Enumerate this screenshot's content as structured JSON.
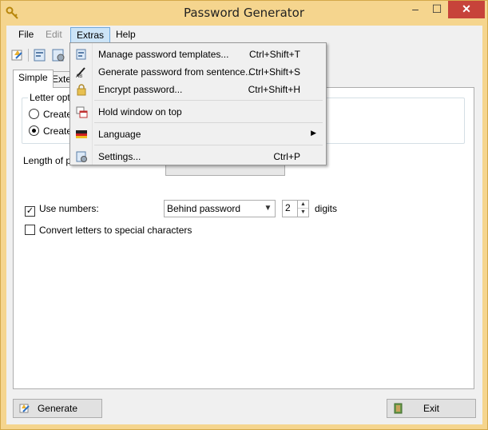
{
  "window": {
    "title": "Password Generator"
  },
  "titlebar_buttons": {
    "minimize": "–",
    "maximize": "☐",
    "close": "✕"
  },
  "menubar": {
    "file": "File",
    "edit": "Edit",
    "extras": "Extras",
    "help": "Help"
  },
  "tabs": {
    "simple": "Simple",
    "extended": "Exte"
  },
  "letter_options": {
    "title": "Letter opti",
    "option1": "Create",
    "option2": "Create",
    "selected_index": 1
  },
  "length": {
    "label": "Length of p"
  },
  "numbers": {
    "checkbox_label": "Use numbers:",
    "checked": true,
    "position_value": "Behind password",
    "count_value": "2",
    "unit": "digits"
  },
  "special_chars": {
    "checkbox_label": "Convert letters to special characters",
    "checked": false
  },
  "buttons": {
    "generate": "Generate",
    "exit": "Exit"
  },
  "extras_menu": {
    "items": [
      {
        "label": "Manage password templates...",
        "shortcut": "Ctrl+Shift+T",
        "icon": "templates-icon"
      },
      {
        "label": "Generate password from sentence...",
        "shortcut": "Ctrl+Shift+S",
        "icon": "sentence-icon"
      },
      {
        "label": "Encrypt password...",
        "shortcut": "Ctrl+Shift+H",
        "icon": "lock-icon"
      },
      {
        "label": "Hold window on top",
        "shortcut": "",
        "icon": "window-on-top-icon"
      },
      {
        "label": "Language",
        "shortcut": "",
        "icon": "flag-icon",
        "submenu_arrow": "▶"
      },
      {
        "label": "Settings...",
        "shortcut": "Ctrl+P",
        "icon": "settings-icon"
      }
    ]
  },
  "colors": {
    "frame": "#f5d58e",
    "close_button": "#c7433a",
    "menu_highlight": "#cce4f7"
  }
}
